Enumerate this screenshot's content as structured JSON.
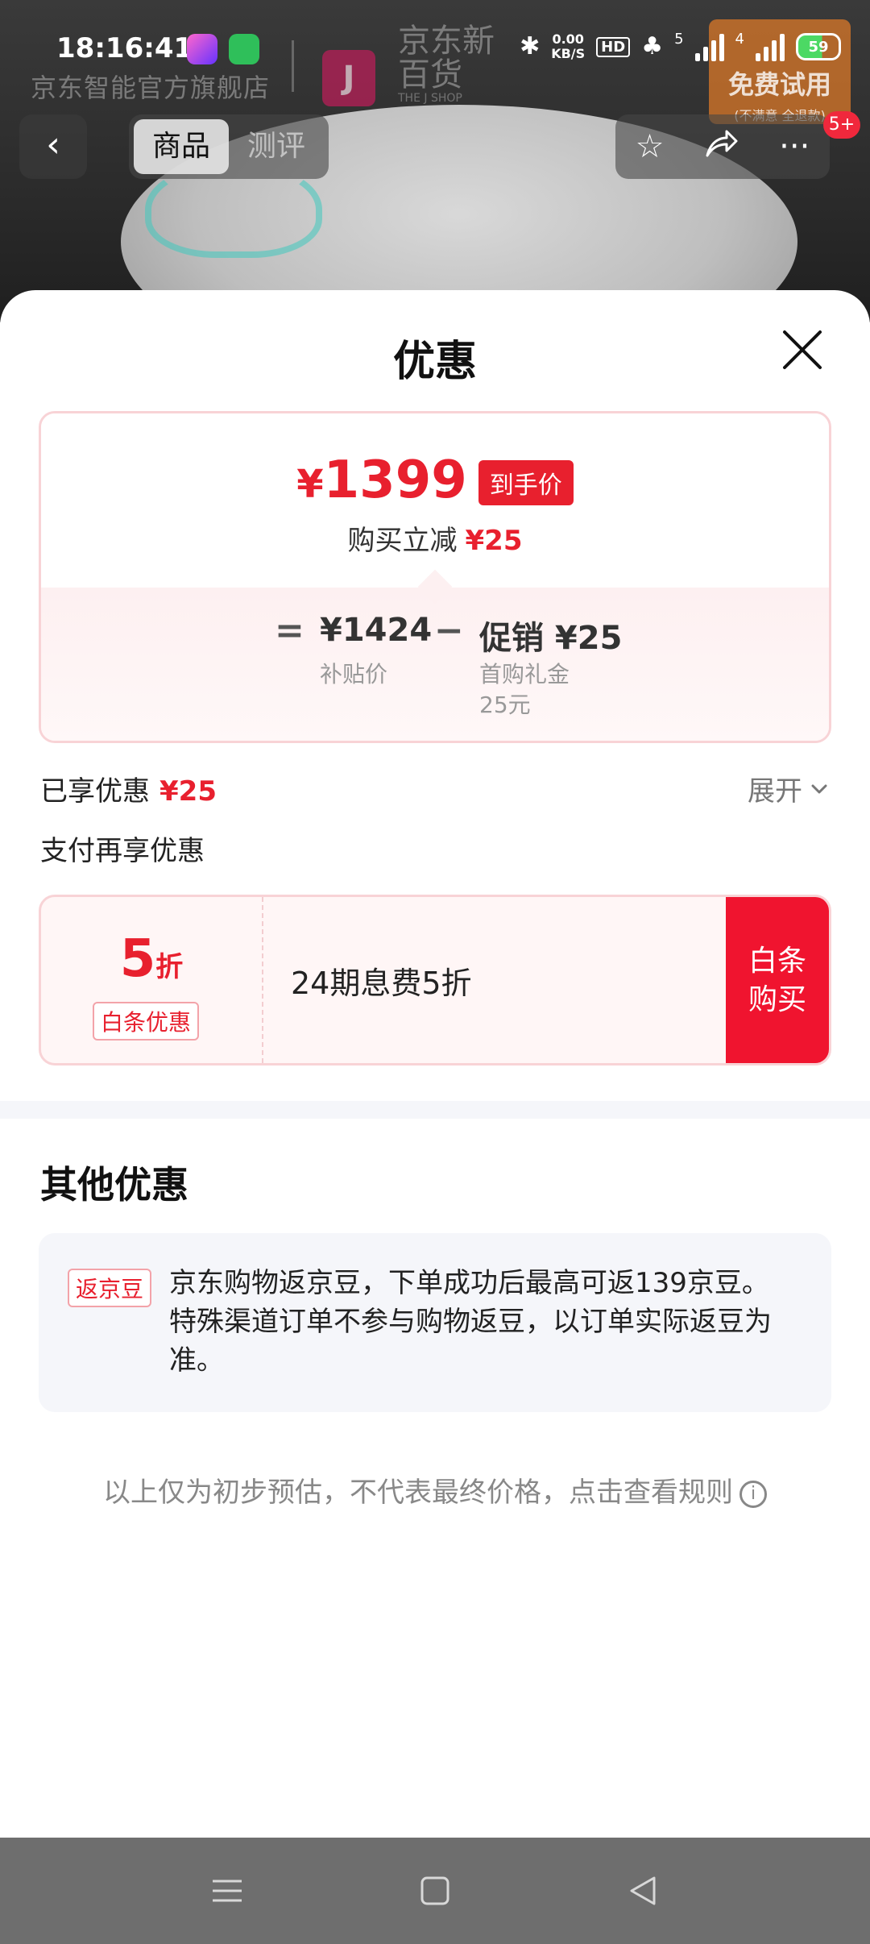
{
  "status_bar": {
    "time": "18:16:41",
    "net_speed_value": "0.00",
    "net_speed_unit": "KB/S",
    "hd_label": "HD",
    "signal_1_label": "5",
    "signal_2_label": "4",
    "battery_level": "59"
  },
  "background": {
    "store_name": "京东智能官方旗舰店",
    "brand_name": "京东新百货",
    "brand_sub": "THE J SHOP",
    "brand_logo_letter": "J",
    "trial_main": "免费试用",
    "trial_sub": "(不满意 全退款)"
  },
  "nav": {
    "tabs": [
      {
        "label": "商品",
        "active": true
      },
      {
        "label": "测评",
        "active": false
      }
    ],
    "badge": "5+"
  },
  "sheet": {
    "title": "优惠",
    "price_card": {
      "currency": "¥",
      "final_price": "1399",
      "final_tag": "到手价",
      "reduce_label": "购买立减",
      "reduce_value": "¥25",
      "equals": "=",
      "minus": "−",
      "base_amount": "¥1424",
      "base_label": "补贴价",
      "promo_amount": "促销 ¥25",
      "promo_label_1": "首购礼金",
      "promo_label_2": "25元"
    },
    "enjoyed_label": "已享优惠",
    "enjoyed_value": "¥25",
    "expand_label": "展开",
    "pay_more_label": "支付再享优惠",
    "baitiao": {
      "discount_num": "5",
      "discount_unit": "折",
      "tag": "白条优惠",
      "desc": "24期息费5折",
      "button_line1": "白条",
      "button_line2": "购买"
    },
    "other_title": "其他优惠",
    "jingdou": {
      "tag": "返京豆",
      "text": "京东购物返京豆，下单成功后最高可返139京豆。特殊渠道订单不参与购物返豆，以订单实际返豆为准。"
    },
    "disclaimer": "以上仅为初步预估，不代表最终价格，点击查看规则",
    "info_glyph": "i"
  },
  "colors": {
    "accent_red": "#e8202e",
    "button_red": "#f0142f"
  }
}
